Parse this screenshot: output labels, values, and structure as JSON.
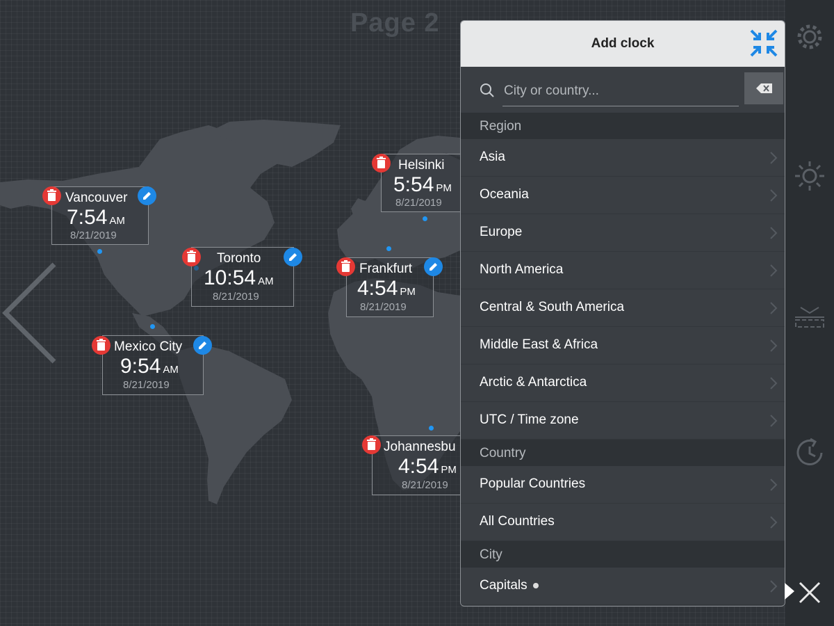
{
  "page": {
    "title": "Page 2"
  },
  "clocks": [
    {
      "id": "vancouver",
      "city": "Vancouver",
      "time": "7:54",
      "ampm": "AM",
      "date": "8/21/2019",
      "editable": true
    },
    {
      "id": "toronto",
      "city": "Toronto",
      "time": "10:54",
      "ampm": "AM",
      "date": "8/21/2019",
      "editable": true
    },
    {
      "id": "mexico-city",
      "city": "Mexico City",
      "time": "9:54",
      "ampm": "AM",
      "date": "8/21/2019",
      "editable": true
    },
    {
      "id": "helsinki",
      "city": "Helsinki",
      "time": "5:54",
      "ampm": "PM",
      "date": "8/21/2019",
      "editable": false
    },
    {
      "id": "frankfurt",
      "city": "Frankfurt",
      "time": "4:54",
      "ampm": "PM",
      "date": "8/21/2019",
      "editable": true
    },
    {
      "id": "johannesburg",
      "city": "Johannesbu",
      "time": "4:54",
      "ampm": "PM",
      "date": "8/21/2019",
      "editable": false
    }
  ],
  "panel": {
    "title": "Add clock",
    "search": {
      "placeholder": "City or country...",
      "value": ""
    },
    "sections": [
      {
        "header": "Region",
        "items": [
          "Asia",
          "Oceania",
          "Europe",
          "North America",
          "Central & South America",
          "Middle East & Africa",
          "Arctic & Antarctica",
          "UTC / Time zone"
        ]
      },
      {
        "header": "Country",
        "items": [
          "Popular Countries",
          "All Countries"
        ]
      },
      {
        "header": "City",
        "items": [
          "Capitals"
        ]
      }
    ]
  },
  "rail_icons": [
    "gear-icon",
    "brightness-icon",
    "display-mode-icon",
    "clock-sync-icon"
  ],
  "colors": {
    "delete": "#e53935",
    "edit": "#1e88e5",
    "accent": "#1e88e5",
    "panel_bg": "#3a3e43",
    "header_bg": "#e7e8e9"
  }
}
